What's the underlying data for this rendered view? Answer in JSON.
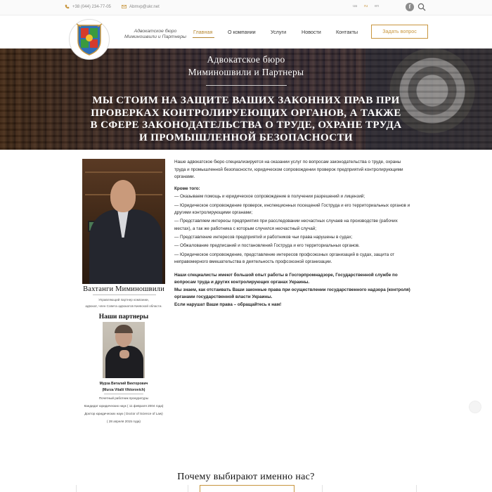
{
  "topbar": {
    "phone": "+38 (044) 234-77-05",
    "email": "Abmvp@ukr.net",
    "languages": [
      "ua",
      "ru",
      "en"
    ],
    "active_language": "ru"
  },
  "header": {
    "brand": "Адвокатское бюро Миминошвили и Партнеры",
    "nav": [
      "Главная",
      "О компании",
      "Услуги",
      "Новости",
      "Контакты"
    ],
    "active_nav": "Главная",
    "ask_button": "Задать вопрос"
  },
  "hero": {
    "title_line1": "Адвокатское бюро",
    "title_line2": "Миминошвили и Партнеры",
    "slogan": "Мы стоим на защите ваших законних прав при проверках контролируеющих органов, а также в сфере законодательства о труде, охране труда и промышленной безопасности"
  },
  "main_person": {
    "name": "Вахтанги Миминошвили",
    "desc_line1": "Управляющий партнер компании,",
    "desc_line2": "адвокат, член Совета адвокатов Киевской области."
  },
  "partners": {
    "heading": "Наши партнеры",
    "name_ru": "Мурза Виталий Викторович",
    "name_en": "(Murza Vitalii Viktorovich)",
    "desc": [
      "Почетный работник прокуратуры",
      "Кандидат юридических наук ( 11 февраля 2004 года)",
      "Доктор юридических наук ( Doctor of Science of Law)",
      "( 28 апреля 2015 года)"
    ]
  },
  "content": {
    "intro": "Наше адвокатское бюро специализируется на оказании услуг по вопросам законодательства о труде, охраны труда и промышленной безопасности, юридическом сопровождении проверок предприятий контролирующими органами.",
    "subheading": "Кроме того:",
    "list": [
      "— Оказываем помощь и юридическое сопровождение в получении разрешений и лицензий;",
      "— Юридическое сопровождение проверок, инспекционных посещений Гоструда и его территориальных органов и другими контролирующими органами;",
      "— Представляем интересы предприятия при расследовании несчастных случаев на производстве (рабочих местах), а так же работника с которым случился несчастный случай;",
      "— Представление интересов предприятий и работников чьи права нарушены в судах;",
      "— Обжалование предписаний и постановлений Гоструда и его территориальных органов.",
      "— Юридическое сопровождение, представление интересов профсоюзных организаций в судах, защита от неправомерного вмешательства в деятельность профсоюзной организации."
    ],
    "closing": [
      "Наши специалисты имеют большой опыт работы в Госгорпромнадзоре, Государственной службе по вопросам труда и других контролирующих органах Украины.",
      "Мы знаем, как отстаивать Ваши законные права при осуществлении государственного надзора (контроля) органами государственной власти Украины.",
      "Если нарушат Ваши права – обращайтесь к нам!"
    ]
  },
  "why": {
    "heading": "Почему выбирают именно нас?"
  },
  "colors": {
    "accent": "#c8963e",
    "nav_active": "#b5862f"
  }
}
